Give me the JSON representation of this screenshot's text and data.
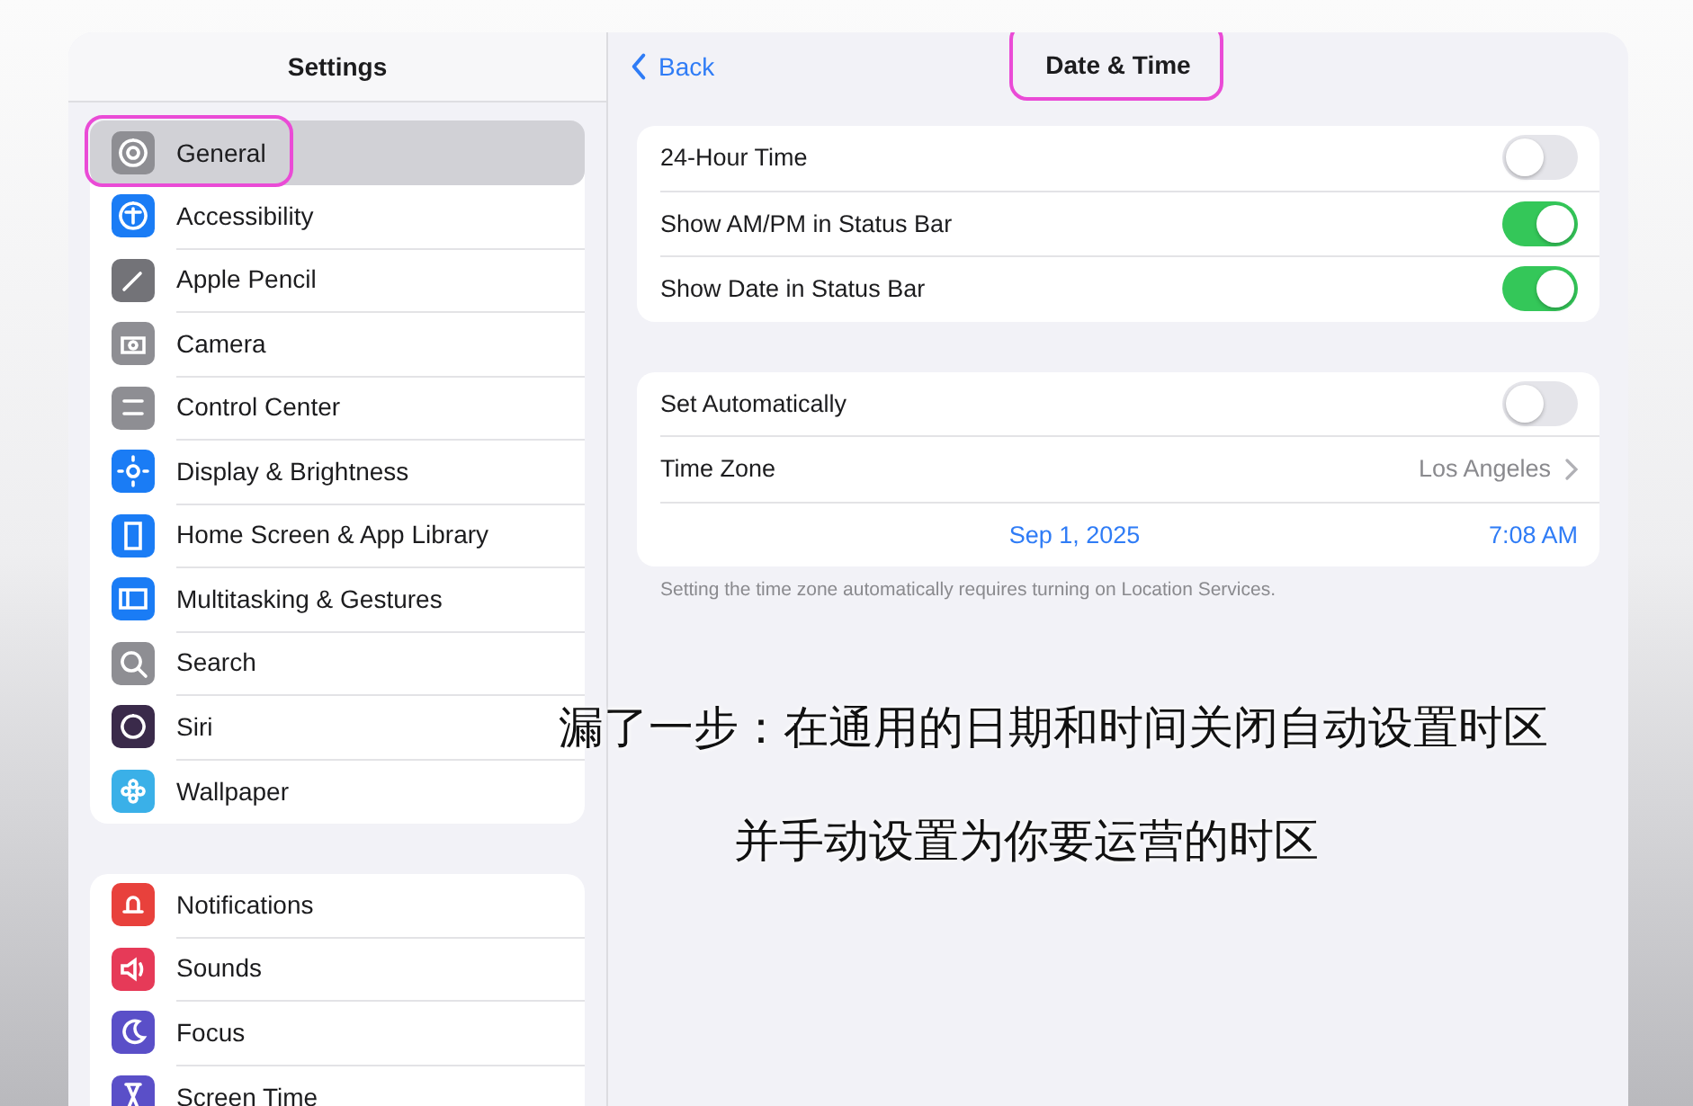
{
  "sidebar": {
    "title": "Settings",
    "groups": [
      {
        "items": [
          {
            "label": "General",
            "color": "#8e8e93",
            "selected": true,
            "highlighted": true
          },
          {
            "label": "Accessibility",
            "color": "#1a7cf5",
            "selected": false,
            "highlighted": false
          },
          {
            "label": "Apple Pencil",
            "color": "#737378",
            "selected": false,
            "highlighted": false
          },
          {
            "label": "Camera",
            "color": "#8e8e93",
            "selected": false,
            "highlighted": false
          },
          {
            "label": "Control Center",
            "color": "#8e8e93",
            "selected": false,
            "highlighted": false
          },
          {
            "label": "Display & Brightness",
            "color": "#1a7cf5",
            "selected": false,
            "highlighted": false
          },
          {
            "label": "Home Screen & App Library",
            "color": "#1a7cf5",
            "selected": false,
            "highlighted": false
          },
          {
            "label": "Multitasking & Gestures",
            "color": "#1a7cf5",
            "selected": false,
            "highlighted": false
          },
          {
            "label": "Search",
            "color": "#8e8e93",
            "selected": false,
            "highlighted": false
          },
          {
            "label": "Siri",
            "color": "#3a2a4a",
            "selected": false,
            "highlighted": false
          },
          {
            "label": "Wallpaper",
            "color": "#3ab0e8",
            "selected": false,
            "highlighted": false
          }
        ]
      },
      {
        "items": [
          {
            "label": "Notifications",
            "color": "#e8413c",
            "selected": false,
            "highlighted": false
          },
          {
            "label": "Sounds",
            "color": "#e63a58",
            "selected": false,
            "highlighted": false
          },
          {
            "label": "Focus",
            "color": "#5a4fc8",
            "selected": false,
            "highlighted": false
          },
          {
            "label": "Screen Time",
            "color": "#5a4fc8",
            "selected": false,
            "highlighted": false
          }
        ]
      }
    ]
  },
  "detail": {
    "back": "Back",
    "title": "Date & Time",
    "title_highlighted": true,
    "groups": [
      {
        "rows": [
          {
            "kind": "toggle",
            "label": "24-Hour Time",
            "on": false
          },
          {
            "kind": "toggle",
            "label": "Show AM/PM in Status Bar",
            "on": true
          },
          {
            "kind": "toggle",
            "label": "Show Date in Status Bar",
            "on": true
          }
        ]
      },
      {
        "rows": [
          {
            "kind": "toggle",
            "label": "Set Automatically",
            "on": false
          },
          {
            "kind": "detail",
            "label": "Time Zone",
            "value": "Los Angeles"
          },
          {
            "kind": "datetime",
            "date": "Sep 1, 2025",
            "time": "7:08 AM"
          }
        ],
        "footer": "Setting the time zone automatically requires turning on Location Services."
      }
    ]
  },
  "subtitles": [
    "漏了一步：在通用的日期和时间关闭自动设置时区",
    "并手动设置为你要运营的时区"
  ]
}
